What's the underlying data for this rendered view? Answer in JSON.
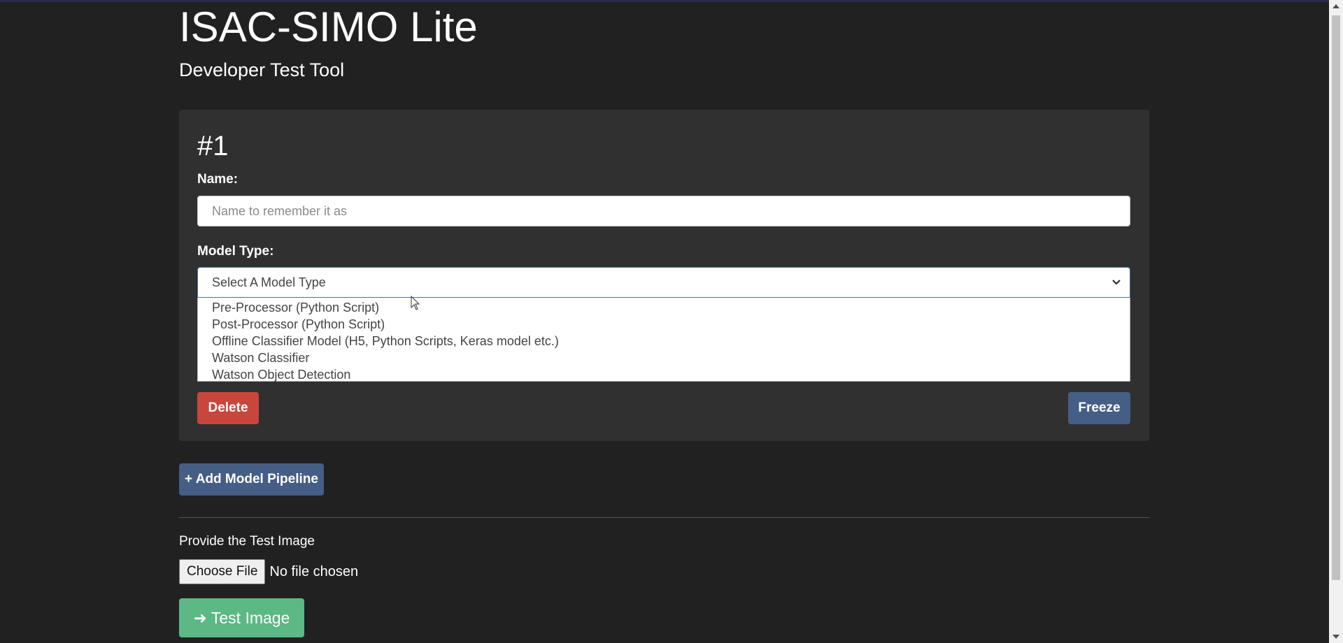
{
  "header": {
    "title": "ISAC-SIMO Lite",
    "subtitle": "Developer Test Tool"
  },
  "pipeline_card": {
    "number": "#1",
    "name_label": "Name:",
    "name_placeholder": "Name to remember it as",
    "name_value": "",
    "model_type_label": "Model Type:",
    "model_type_selected": "Select A Model Type",
    "model_type_options": [
      "Pre-Processor (Python Script)",
      "Post-Processor (Python Script)",
      "Offline Classifier Model (H5, Python Scripts, Keras model etc.)",
      "Watson Classifier",
      "Watson Object Detection"
    ],
    "delete_label": "Delete",
    "freeze_label": "Freeze"
  },
  "add_pipeline_label": "+ Add Model Pipeline",
  "test_image": {
    "label": "Provide the Test Image",
    "choose_file_label": "Choose File",
    "file_status": "No file chosen",
    "test_button_label": "➜ Test Image"
  },
  "colors": {
    "background": "#212121",
    "card": "#303030",
    "delete": "#c9463d",
    "primary": "#455e86",
    "success": "#5cb885"
  },
  "icons": {
    "select_arrow": "chevron-down-icon",
    "cursor": "mouse-cursor-icon"
  }
}
